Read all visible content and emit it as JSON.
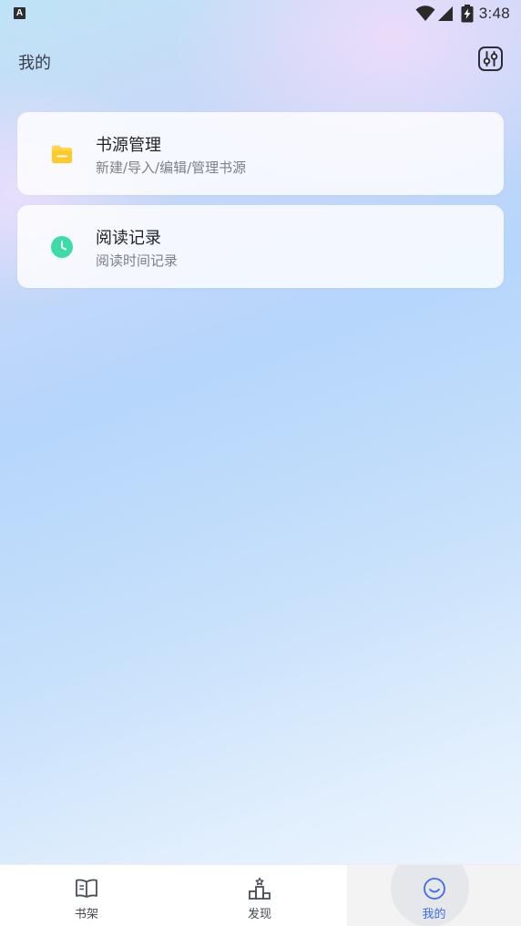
{
  "status_bar": {
    "notification_badge": "A",
    "time": "3:48",
    "icons": [
      "wifi-icon",
      "signal-icon",
      "battery-charging-icon"
    ]
  },
  "header": {
    "title": "我的",
    "settings_icon": "sliders-icon"
  },
  "menu": [
    {
      "title": "书源管理",
      "subtitle": "新建/导入/编辑/管理书源",
      "icon": "folder-icon",
      "icon_color": "#FFD54F"
    },
    {
      "title": "阅读记录",
      "subtitle": "阅读时间记录",
      "icon": "clock-icon",
      "icon_color": "#3DDBA6"
    }
  ],
  "bottom_nav": {
    "items": [
      {
        "label": "书架",
        "icon": "book-icon",
        "active": false
      },
      {
        "label": "发现",
        "icon": "podium-icon",
        "active": false
      },
      {
        "label": "我的",
        "icon": "smile-icon",
        "active": true
      }
    ],
    "active_color": "#3A6CF0"
  }
}
